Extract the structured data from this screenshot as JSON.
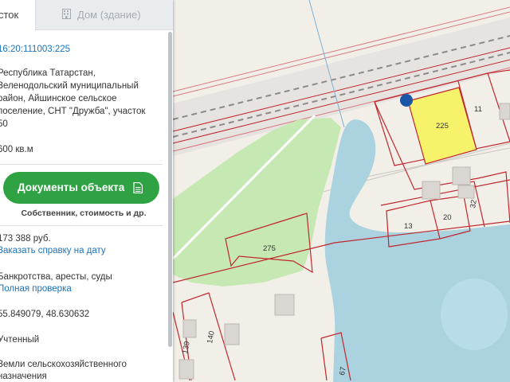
{
  "tabs": {
    "parcel_fragment": "сток",
    "building": "Дом (здание)"
  },
  "parcel": {
    "cadastral_number": "16:20:111003:225",
    "address_lines": [
      "Республика Татарстан,",
      "Зеленодольский муниципальный",
      "район, Айшинское сельское",
      "поселение, СНТ \"Дружба\", участок",
      "50"
    ],
    "area": "600 кв.м",
    "documents_button": "Документы объекта",
    "documents_sub": "Собственник, стоимость и др.",
    "cost": "173 388 руб.",
    "order_link": "Заказать справку на дату",
    "checks": "Банкротства, аресты, суды",
    "full_check_link": "Полная проверка",
    "coords": "55.849079, 48.630632",
    "status": "Учтенный",
    "category_lines": [
      "Земли сельскохозяйственного",
      "назначения"
    ]
  },
  "map": {
    "lot_labels": [
      "225",
      "11",
      "275",
      "13",
      "20",
      "32",
      "139",
      "140",
      "67"
    ],
    "colors": {
      "selected_fill": "#f6f36b",
      "boundary": "#c0272d",
      "water": "#aad3df",
      "park": "#c6e8b2",
      "marker": "#1a56a6",
      "button": "#2fa344",
      "link": "#1e72b8"
    }
  }
}
